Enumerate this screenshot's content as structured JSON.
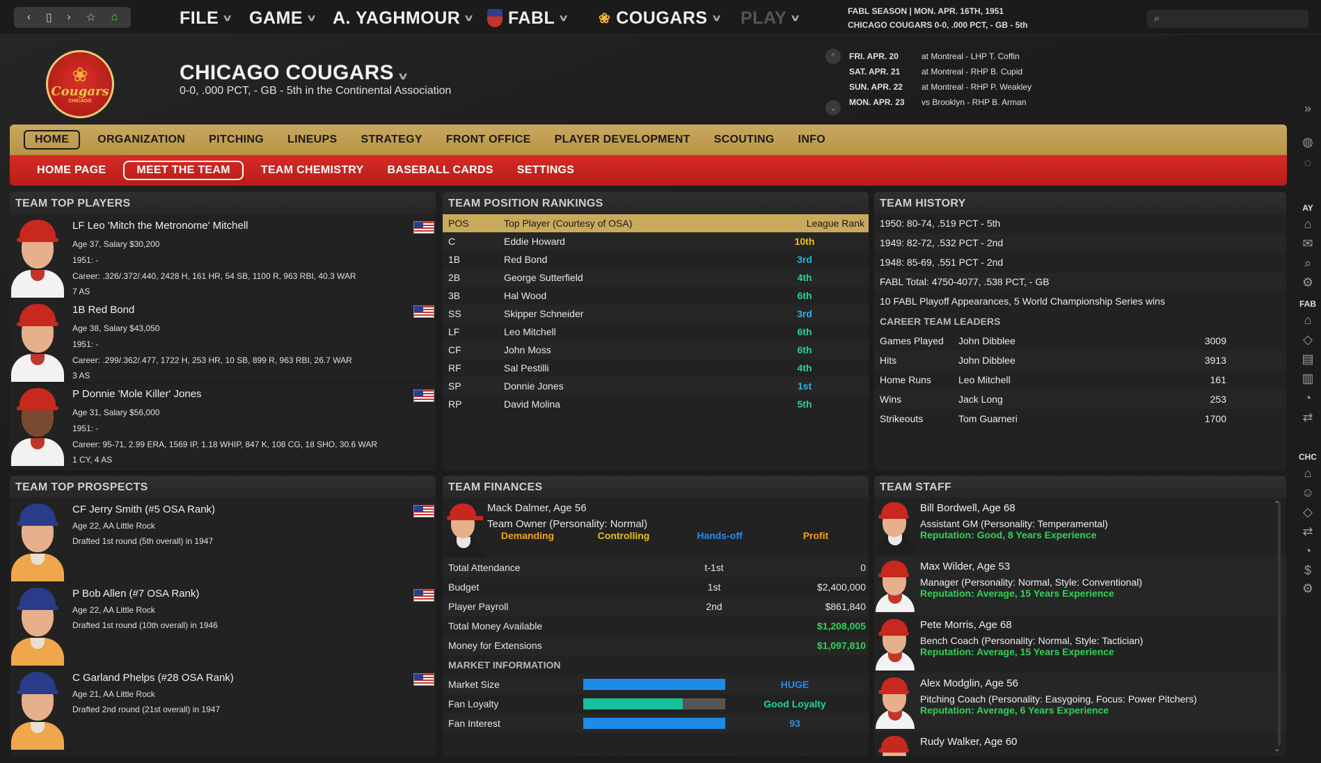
{
  "toolbar": {
    "back": "‹",
    "page": "▯",
    "forward": "›",
    "star": "☆",
    "home": "⌂"
  },
  "menus": [
    {
      "label": "FILE"
    },
    {
      "label": "GAME"
    },
    {
      "label": "A. YAGHMOUR"
    },
    {
      "label": "FABL"
    },
    {
      "label": "COUGARS"
    },
    {
      "label": "PLAY"
    }
  ],
  "season": {
    "line1": "FABL SEASON  |  MON. APR. 16TH, 1951",
    "line2": "CHICAGO COUGARS   0-0, .000 PCT, - GB - 5th"
  },
  "logo": {
    "text": "Cougars",
    "sub": "CHICAGO"
  },
  "team": {
    "title": "CHICAGO COUGARS",
    "record": "0-0, .000 PCT, - GB - 5th in the Continental Association"
  },
  "schedule": [
    {
      "date": "FRI. APR. 20",
      "opp": "at Montreal - LHP T. Coffin"
    },
    {
      "date": "SAT. APR. 21",
      "opp": "at Montreal - RHP B. Cupid"
    },
    {
      "date": "SUN. APR. 22",
      "opp": "at Montreal - RHP P. Weakley"
    },
    {
      "date": "MON. APR. 23",
      "opp": "vs Brooklyn - RHP B. Arman"
    }
  ],
  "mainnav": [
    "HOME",
    "ORGANIZATION",
    "PITCHING",
    "LINEUPS",
    "STRATEGY",
    "FRONT OFFICE",
    "PLAYER DEVELOPMENT",
    "SCOUTING",
    "INFO"
  ],
  "subnav": [
    "HOME PAGE",
    "MEET THE TEAM",
    "TEAM CHEMISTRY",
    "BASEBALL CARDS",
    "SETTINGS"
  ],
  "top_players": {
    "title": "TEAM TOP PLAYERS",
    "players": [
      {
        "name": "LF Leo 'Mitch the Metronome' Mitchell",
        "age": "Age 37, Salary $30,200",
        "season": "1951: -",
        "career": "Career: .326/.372/.440, 2428 H, 161 HR, 54 SB, 1100 R, 963 RBI, 40.3 WAR",
        "awards": "7 AS"
      },
      {
        "name": "1B Red Bond",
        "age": "Age 38, Salary $43,050",
        "season": "1951: -",
        "career": "Career: .299/.362/.477, 1722 H, 253 HR, 10 SB, 899 R, 963 RBI, 26.7 WAR",
        "awards": "3 AS"
      },
      {
        "name": "P Donnie 'Mole Killer' Jones",
        "age": "Age 31, Salary $56,000",
        "season": "1951: -",
        "career": "Career: 95-71, 2.99 ERA, 1569 IP, 1.18 WHIP, 847 K, 108 CG, 18 SHO, 30.6 WAR",
        "awards": "1 CY, 4 AS"
      }
    ]
  },
  "rankings": {
    "title": "TEAM POSITION RANKINGS",
    "col_pos": "POS",
    "col_player": "Top Player (Courtesy of OSA)",
    "col_rank": "League Rank",
    "rows": [
      {
        "pos": "C",
        "player": "Eddie Howard",
        "rank": "10th",
        "color": "#f2c21c"
      },
      {
        "pos": "1B",
        "player": "Red Bond",
        "rank": "3rd",
        "color": "#2cb4e8"
      },
      {
        "pos": "2B",
        "player": "George Sutterfield",
        "rank": "4th",
        "color": "#23d49c"
      },
      {
        "pos": "3B",
        "player": "Hal Wood",
        "rank": "6th",
        "color": "#23d49c"
      },
      {
        "pos": "SS",
        "player": "Skipper Schneider",
        "rank": "3rd",
        "color": "#2cb4e8"
      },
      {
        "pos": "LF",
        "player": "Leo Mitchell",
        "rank": "6th",
        "color": "#23d49c"
      },
      {
        "pos": "CF",
        "player": "John Moss",
        "rank": "6th",
        "color": "#23d49c"
      },
      {
        "pos": "RF",
        "player": "Sal Pestilli",
        "rank": "4th",
        "color": "#23d49c"
      },
      {
        "pos": "SP",
        "player": "Donnie Jones",
        "rank": "1st",
        "color": "#2cb4e8"
      },
      {
        "pos": "RP",
        "player": "David Molina",
        "rank": "5th",
        "color": "#23d49c"
      }
    ]
  },
  "history": {
    "title": "TEAM HISTORY",
    "lines": [
      "1950: 80-74, .519 PCT - 5th",
      "1949: 82-72, .532 PCT - 2nd",
      "1948: 85-69, .551 PCT - 2nd",
      "FABL Total: 4750-4077, .538 PCT, - GB",
      "10 FABL Playoff Appearances, 5 World Championship Series wins"
    ],
    "leaders_title": "CAREER TEAM LEADERS",
    "leaders": [
      {
        "cat": "Games Played",
        "name": "John Dibblee",
        "val": "3009"
      },
      {
        "cat": "Hits",
        "name": "John Dibblee",
        "val": "3913"
      },
      {
        "cat": "Home Runs",
        "name": "Leo Mitchell",
        "val": "161"
      },
      {
        "cat": "Wins",
        "name": "Jack Long",
        "val": "253"
      },
      {
        "cat": "Strikeouts",
        "name": "Tom Guarneri",
        "val": "1700"
      }
    ]
  },
  "prospects": {
    "title": "TEAM TOP PROSPECTS",
    "players": [
      {
        "name": "CF Jerry Smith (#5 OSA Rank)",
        "age": "Age 22, AA Little Rock",
        "draft": "Drafted 1st round (5th overall) in 1947"
      },
      {
        "name": "P Bob Allen (#7 OSA Rank)",
        "age": "Age 22, AA Little Rock",
        "draft": "Drafted 1st round (10th overall) in 1946"
      },
      {
        "name": "C Garland Phelps (#28 OSA Rank)",
        "age": "Age 21, AA Little Rock",
        "draft": "Drafted 2nd round (21st overall) in 1947"
      }
    ]
  },
  "finances": {
    "title": "TEAM FINANCES",
    "owner_name": "Mack Dalmer, Age 56",
    "owner_role": "Team Owner (Personality: Normal)",
    "traits": [
      {
        "label": "Demanding",
        "color": "#f2a21c"
      },
      {
        "label": "Controlling",
        "color": "#e8c21c"
      },
      {
        "label": "Hands-off",
        "color": "#2c8ce8"
      },
      {
        "label": "Profit",
        "color": "#f2a21c"
      }
    ],
    "rows": [
      {
        "label": "Total Attendance",
        "mid": "t-1st",
        "val": "0",
        "green": false
      },
      {
        "label": "Budget",
        "mid": "1st",
        "val": "$2,400,000",
        "green": false
      },
      {
        "label": "Player Payroll",
        "mid": "2nd",
        "val": "$861,840",
        "green": false
      },
      {
        "label": "Total Money Available",
        "mid": "",
        "val": "$1,208,005",
        "green": true
      },
      {
        "label": "Money for Extensions",
        "mid": "",
        "val": "$1,097,810",
        "green": true
      }
    ],
    "market_title": "MARKET INFORMATION",
    "market": [
      {
        "label": "Market Size",
        "fill": 1.0,
        "color": "#1c8ce8",
        "value": "HUGE",
        "value_color": "#2c8ce8"
      },
      {
        "label": "Fan Loyalty",
        "fill": 0.7,
        "color": "#18c09c",
        "value": "Good Loyalty",
        "value_color": "#23d49c"
      },
      {
        "label": "Fan Interest",
        "fill": 1.0,
        "color": "#1c8ce8",
        "value": "93",
        "value_color": "#2c8ce8"
      }
    ]
  },
  "staff": {
    "title": "TEAM STAFF",
    "members": [
      {
        "name": "Bill Bordwell, Age 68",
        "role": "Assistant GM (Personality: Temperamental)",
        "rep": "Reputation: Good, 8 Years Experience",
        "suit": true
      },
      {
        "name": "Max Wilder, Age 53",
        "role": "Manager (Personality: Normal, Style: Conventional)",
        "rep": "Reputation: Average, 15 Years Experience",
        "suit": false
      },
      {
        "name": "Pete Morris, Age 68",
        "role": "Bench Coach (Personality: Normal, Style: Tactician)",
        "rep": "Reputation: Average, 15 Years Experience",
        "suit": false
      },
      {
        "name": "Alex Modglin, Age 56",
        "role": "Pitching Coach (Personality: Easygoing, Focus: Power Pitchers)",
        "rep": "Reputation: Average, 6 Years Experience",
        "suit": false
      },
      {
        "name": "Rudy Walker, Age 60",
        "role": "",
        "rep": "",
        "suit": false
      }
    ]
  },
  "sidebar_labels": {
    "ay": "AY",
    "fab": "FAB",
    "chc": "CHC"
  }
}
